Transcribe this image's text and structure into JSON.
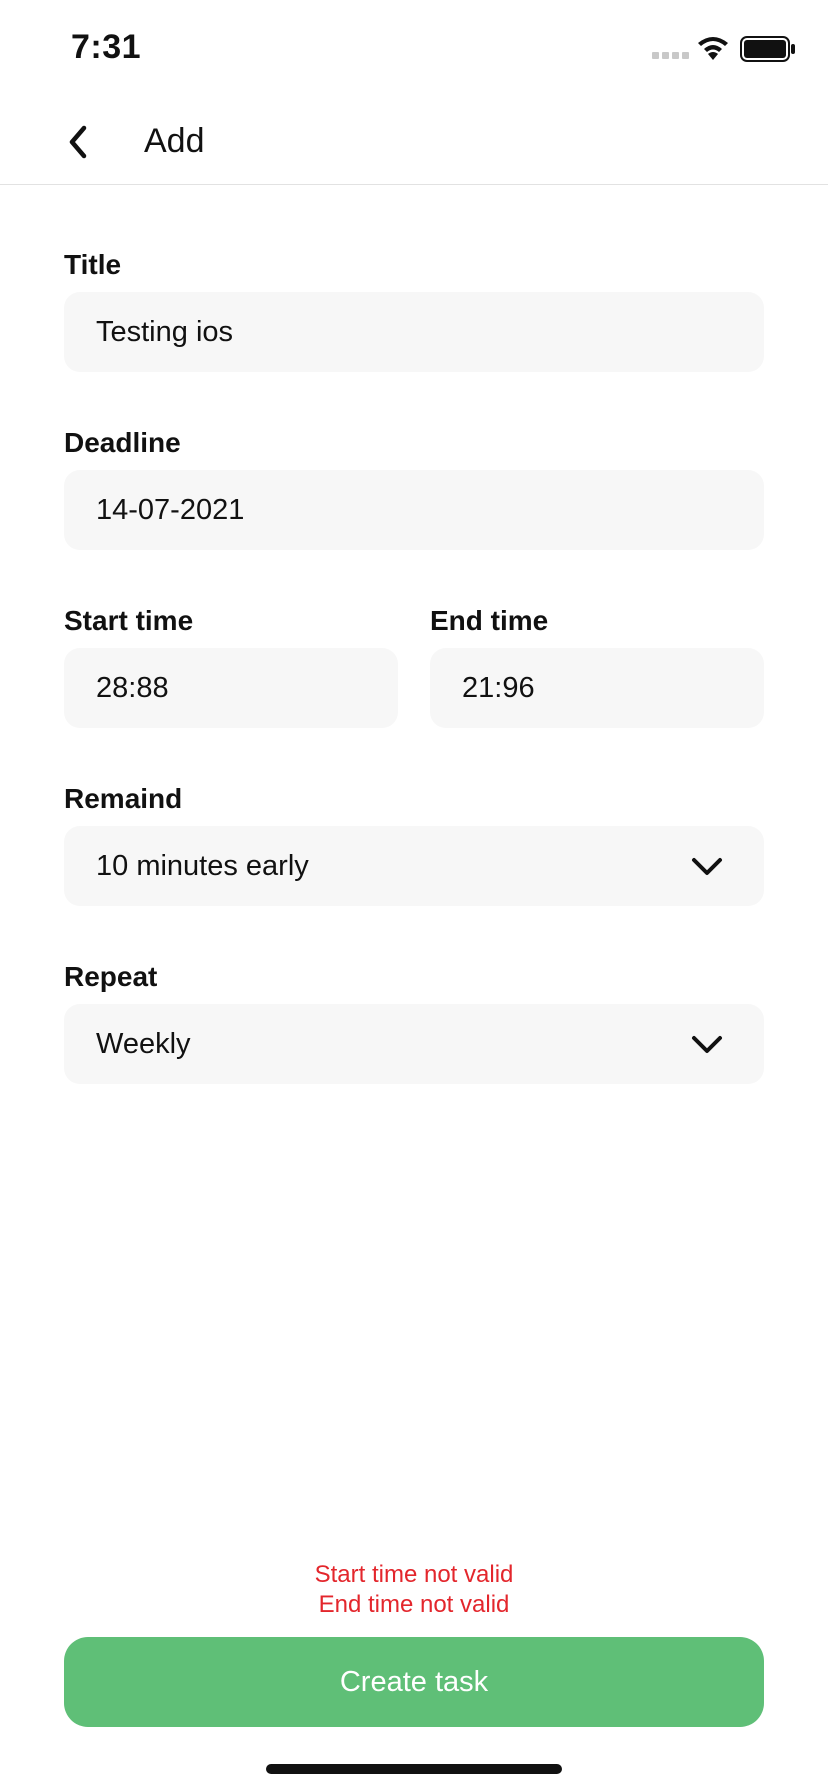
{
  "status": {
    "time": "7:31"
  },
  "nav": {
    "title": "Add"
  },
  "form": {
    "title": {
      "label": "Title",
      "value": "Testing ios"
    },
    "deadline": {
      "label": "Deadline",
      "value": "14-07-2021"
    },
    "start_time": {
      "label": "Start time",
      "value": "28:88"
    },
    "end_time": {
      "label": "End time",
      "value": "21:96"
    },
    "remind": {
      "label": "Remaind",
      "value": "10 minutes early"
    },
    "repeat": {
      "label": "Repeat",
      "value": "Weekly"
    }
  },
  "errors": [
    "Start time not valid",
    "End time not valid"
  ],
  "actions": {
    "create_label": "Create task"
  },
  "colors": {
    "accent": "#5fbf77",
    "error": "#e3262c",
    "field_bg": "#f7f7f7"
  },
  "icons": {
    "back": "chevron-left-icon",
    "dropdown": "chevron-down-icon",
    "wifi": "wifi-icon",
    "battery": "battery-icon"
  }
}
